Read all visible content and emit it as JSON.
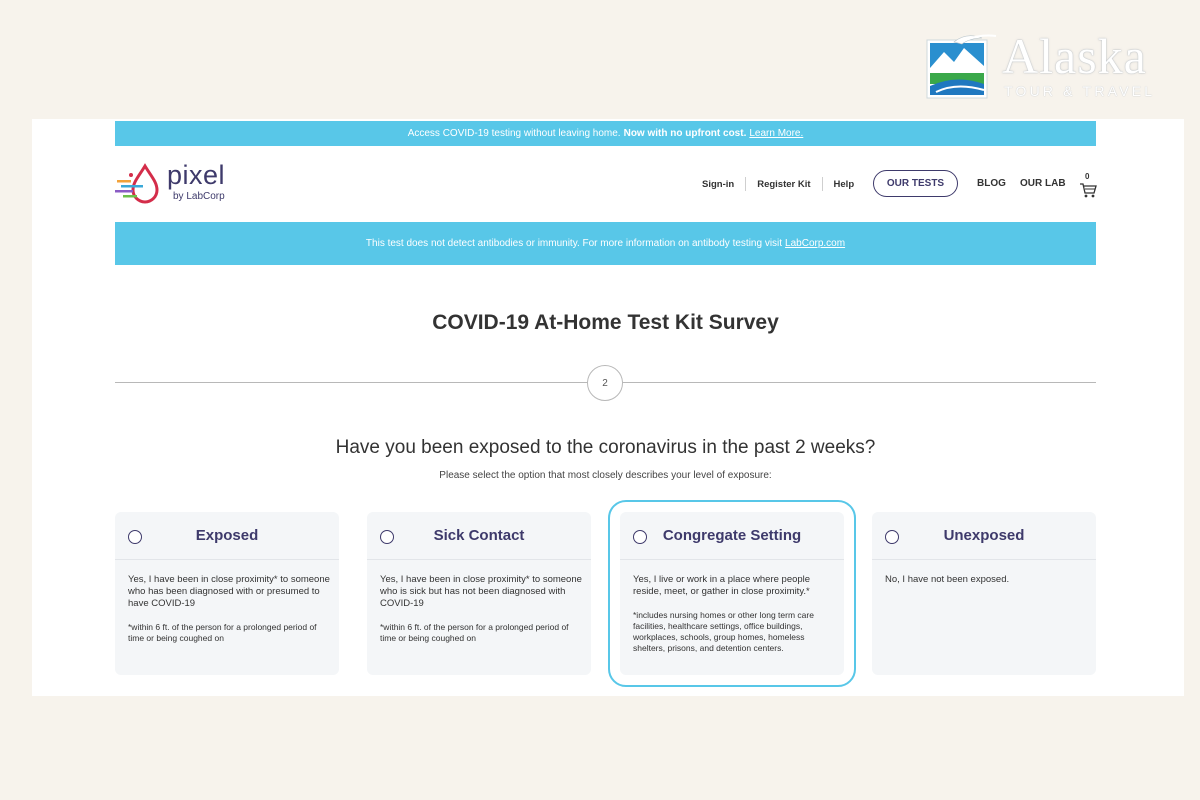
{
  "brand": {
    "name": "Alaska",
    "tagline": "TOUR & TRAVEL"
  },
  "promo_bar": {
    "text": "Access COVID-19 testing without leaving home.",
    "bold": "Now with no upfront cost.",
    "link": "Learn More."
  },
  "header": {
    "logo_name": "pixel",
    "logo_sub": "by LabCorp",
    "utility_nav": [
      "Sign-in",
      "Register Kit",
      "Help"
    ],
    "our_tests_label": "OUR TESTS",
    "blog_label": "BLOG",
    "lab_label": "OUR LAB",
    "cart_count": "0"
  },
  "info_bar": {
    "text": "This test does not detect antibodies or immunity. For more information on antibody testing visit",
    "link": "LabCorp.com"
  },
  "survey": {
    "title": "COVID-19 At-Home Test Kit Survey",
    "step": "2",
    "question": "Have you been exposed to the coronavirus in the past 2 weeks?",
    "instruction": "Please select the option that most closely describes your level of exposure:"
  },
  "options": [
    {
      "title": "Exposed",
      "description": "Yes, I have been in close proximity* to someone who has been diagnosed with or presumed to have COVID-19",
      "note": "*within 6 ft. of the person for a prolonged period of time or being coughed on"
    },
    {
      "title": "Sick Contact",
      "description": "Yes, I have been in close proximity* to someone who is sick but has not been diagnosed with COVID-19",
      "note": "*within 6 ft. of the person for a prolonged period of time or being coughed on"
    },
    {
      "title": "Congregate Setting",
      "description": "Yes, I live or work in a place where people reside, meet, or gather in close proximity.*",
      "note": "*includes nursing homes or other long term care facilities, healthcare settings, office buildings, workplaces, schools, group homes, homeless shelters, prisons, and detention centers."
    },
    {
      "title": "Unexposed",
      "description": "No, I have not been exposed.",
      "note": ""
    }
  ],
  "colors": {
    "accent_blue": "#58c7e8",
    "brand_navy": "#3e3a6b",
    "page_background": "#f7f3ec"
  }
}
